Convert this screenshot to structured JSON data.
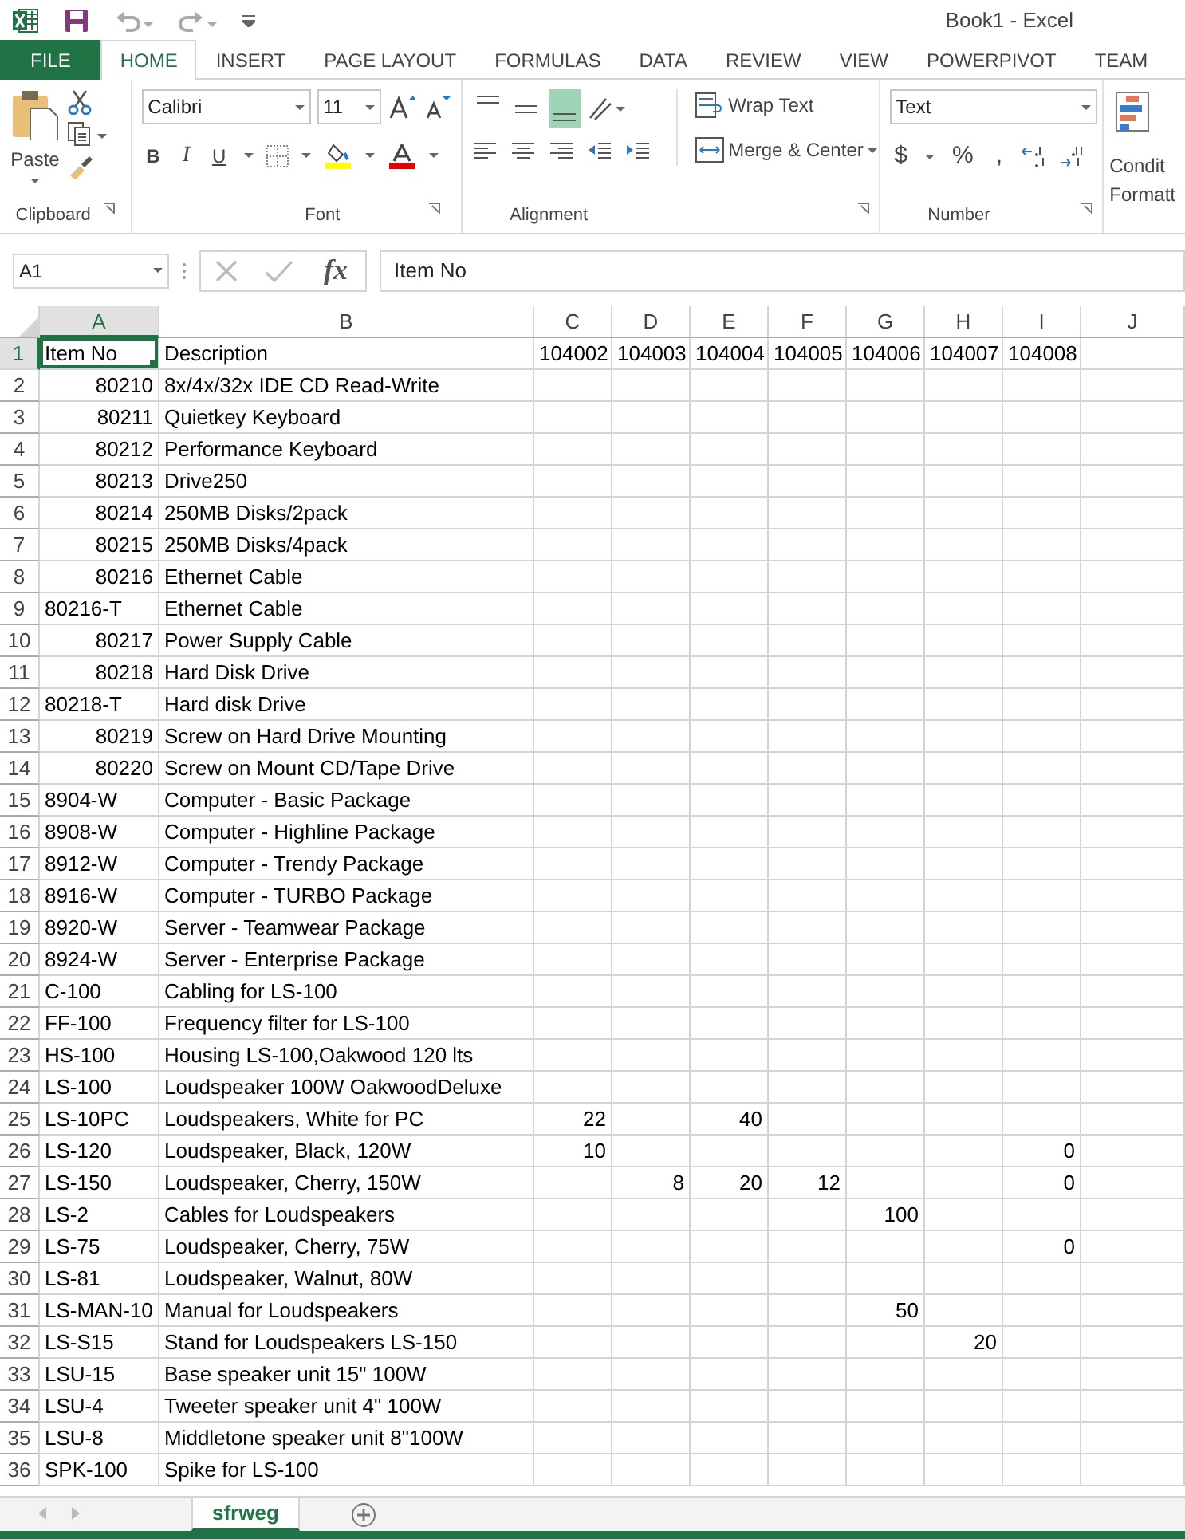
{
  "window": {
    "title": "Book1 - Excel"
  },
  "ribbon_tabs": [
    {
      "label": "FILE",
      "kind": "file",
      "selected": false
    },
    {
      "label": "HOME",
      "kind": "tab",
      "selected": true
    },
    {
      "label": "INSERT",
      "kind": "tab",
      "selected": false
    },
    {
      "label": "PAGE LAYOUT",
      "kind": "tab",
      "selected": false
    },
    {
      "label": "FORMULAS",
      "kind": "tab",
      "selected": false
    },
    {
      "label": "DATA",
      "kind": "tab",
      "selected": false
    },
    {
      "label": "REVIEW",
      "kind": "tab",
      "selected": false
    },
    {
      "label": "VIEW",
      "kind": "tab",
      "selected": false
    },
    {
      "label": "POWERPIVOT",
      "kind": "tab",
      "selected": false
    },
    {
      "label": "TEAM",
      "kind": "tab",
      "selected": false
    }
  ],
  "clipboard": {
    "paste_label": "Paste",
    "group_label": "Clipboard"
  },
  "font": {
    "name": "Calibri",
    "size": "11",
    "bold": "B",
    "italic": "I",
    "underline": "U",
    "group_label": "Font"
  },
  "alignment": {
    "vertical_buttons": [
      {
        "kind": "top",
        "selected": false
      },
      {
        "kind": "middle",
        "selected": false
      },
      {
        "kind": "bottom",
        "selected": true
      }
    ],
    "wrap_text": "Wrap Text",
    "merge_center": "Merge & Center",
    "group_label": "Alignment"
  },
  "number": {
    "format": "Text",
    "buttons": [
      "$",
      "%",
      ","
    ],
    "group_label": "Number"
  },
  "styles": {
    "conditional_formatting": [
      "Condit",
      "Formatt"
    ]
  },
  "formula_bar": {
    "name_box": "A1",
    "function_label": "fx",
    "content": "Item No"
  },
  "sheet": {
    "columns": [
      {
        "label": "A",
        "selected": true
      },
      {
        "label": "B",
        "selected": false
      },
      {
        "label": "C",
        "selected": false
      },
      {
        "label": "D",
        "selected": false
      },
      {
        "label": "E",
        "selected": false
      },
      {
        "label": "F",
        "selected": false
      },
      {
        "label": "G",
        "selected": false
      },
      {
        "label": "H",
        "selected": false
      },
      {
        "label": "I",
        "selected": false
      },
      {
        "label": "J",
        "selected": false
      }
    ],
    "rows": [
      {
        "number": "1",
        "selected": true,
        "item": {
          "text": "Item No",
          "kind": "text"
        },
        "description": "Description",
        "values": {
          "c": "104002",
          "d": "104003",
          "e": "104004",
          "f": "104005",
          "g": "104006",
          "h": "104007",
          "i": "104008"
        }
      },
      {
        "number": "2",
        "selected": false,
        "item": {
          "text": "80210",
          "kind": "number"
        },
        "description": "8x/4x/32x IDE CD Read-Write"
      },
      {
        "number": "3",
        "selected": false,
        "item": {
          "text": "80211",
          "kind": "number"
        },
        "description": "Quietkey Keyboard"
      },
      {
        "number": "4",
        "selected": false,
        "item": {
          "text": "80212",
          "kind": "number"
        },
        "description": "Performance Keyboard"
      },
      {
        "number": "5",
        "selected": false,
        "item": {
          "text": "80213",
          "kind": "number"
        },
        "description": "Drive250"
      },
      {
        "number": "6",
        "selected": false,
        "item": {
          "text": "80214",
          "kind": "number"
        },
        "description": "250MB Disks/2pack"
      },
      {
        "number": "7",
        "selected": false,
        "item": {
          "text": "80215",
          "kind": "number"
        },
        "description": "250MB Disks/4pack"
      },
      {
        "number": "8",
        "selected": false,
        "item": {
          "text": "80216",
          "kind": "number"
        },
        "description": "Ethernet Cable"
      },
      {
        "number": "9",
        "selected": false,
        "item": {
          "text": "80216-T",
          "kind": "text"
        },
        "description": "Ethernet Cable"
      },
      {
        "number": "10",
        "selected": false,
        "item": {
          "text": "80217",
          "kind": "number"
        },
        "description": "Power Supply Cable"
      },
      {
        "number": "11",
        "selected": false,
        "item": {
          "text": "80218",
          "kind": "number"
        },
        "description": "Hard Disk Drive"
      },
      {
        "number": "12",
        "selected": false,
        "item": {
          "text": "80218-T",
          "kind": "text"
        },
        "description": "Hard disk Drive"
      },
      {
        "number": "13",
        "selected": false,
        "item": {
          "text": "80219",
          "kind": "number"
        },
        "description": "Screw on Hard Drive Mounting"
      },
      {
        "number": "14",
        "selected": false,
        "item": {
          "text": "80220",
          "kind": "number"
        },
        "description": "Screw on Mount CD/Tape Drive"
      },
      {
        "number": "15",
        "selected": false,
        "item": {
          "text": "8904-W",
          "kind": "text"
        },
        "description": "Computer - Basic Package"
      },
      {
        "number": "16",
        "selected": false,
        "item": {
          "text": "8908-W",
          "kind": "text"
        },
        "description": "Computer - Highline Package"
      },
      {
        "number": "17",
        "selected": false,
        "item": {
          "text": "8912-W",
          "kind": "text"
        },
        "description": "Computer - Trendy Package"
      },
      {
        "number": "18",
        "selected": false,
        "item": {
          "text": "8916-W",
          "kind": "text"
        },
        "description": "Computer - TURBO Package"
      },
      {
        "number": "19",
        "selected": false,
        "item": {
          "text": "8920-W",
          "kind": "text"
        },
        "description": "Server - Teamwear Package"
      },
      {
        "number": "20",
        "selected": false,
        "item": {
          "text": "8924-W",
          "kind": "text"
        },
        "description": "Server - Enterprise Package"
      },
      {
        "number": "21",
        "selected": false,
        "item": {
          "text": "C-100",
          "kind": "text"
        },
        "description": "Cabling for LS-100"
      },
      {
        "number": "22",
        "selected": false,
        "item": {
          "text": "FF-100",
          "kind": "text"
        },
        "description": "Frequency filter for LS-100"
      },
      {
        "number": "23",
        "selected": false,
        "item": {
          "text": "HS-100",
          "kind": "text"
        },
        "description": "Housing LS-100,Oakwood 120 lts"
      },
      {
        "number": "24",
        "selected": false,
        "item": {
          "text": "LS-100",
          "kind": "text"
        },
        "description": "Loudspeaker 100W OakwoodDeluxe"
      },
      {
        "number": "25",
        "selected": false,
        "item": {
          "text": "LS-10PC",
          "kind": "text"
        },
        "description": "Loudspeakers, White for PC",
        "values": {
          "c": "22",
          "e": "40"
        }
      },
      {
        "number": "26",
        "selected": false,
        "item": {
          "text": "LS-120",
          "kind": "text"
        },
        "description": "Loudspeaker, Black, 120W",
        "values": {
          "c": "10",
          "i": "0"
        }
      },
      {
        "number": "27",
        "selected": false,
        "item": {
          "text": "LS-150",
          "kind": "text"
        },
        "description": "Loudspeaker, Cherry, 150W",
        "values": {
          "d": "8",
          "e": "20",
          "f": "12",
          "i": "0"
        }
      },
      {
        "number": "28",
        "selected": false,
        "item": {
          "text": "LS-2",
          "kind": "text"
        },
        "description": "Cables for Loudspeakers",
        "values": {
          "g": "100"
        }
      },
      {
        "number": "29",
        "selected": false,
        "item": {
          "text": "LS-75",
          "kind": "text"
        },
        "description": "Loudspeaker, Cherry, 75W",
        "values": {
          "i": "0"
        }
      },
      {
        "number": "30",
        "selected": false,
        "item": {
          "text": "LS-81",
          "kind": "text"
        },
        "description": "Loudspeaker, Walnut, 80W"
      },
      {
        "number": "31",
        "selected": false,
        "item": {
          "text": "LS-MAN-10",
          "kind": "text"
        },
        "description": "Manual for Loudspeakers",
        "values": {
          "g": "50"
        }
      },
      {
        "number": "32",
        "selected": false,
        "item": {
          "text": "LS-S15",
          "kind": "text"
        },
        "description": "Stand for Loudspeakers LS-150",
        "values": {
          "h": "20"
        }
      },
      {
        "number": "33",
        "selected": false,
        "item": {
          "text": "LSU-15",
          "kind": "text"
        },
        "description": "Base speaker unit 15\" 100W"
      },
      {
        "number": "34",
        "selected": false,
        "item": {
          "text": "LSU-4",
          "kind": "text"
        },
        "description": "Tweeter speaker unit 4\" 100W"
      },
      {
        "number": "35",
        "selected": false,
        "item": {
          "text": "LSU-8",
          "kind": "text"
        },
        "description": "Middletone speaker unit 8\"100W"
      },
      {
        "number": "36",
        "selected": false,
        "item": {
          "text": "SPK-100",
          "kind": "text"
        },
        "description": "Spike for LS-100"
      }
    ]
  },
  "sheet_tabs": [
    {
      "label": "sfrweg",
      "selected": true
    }
  ]
}
